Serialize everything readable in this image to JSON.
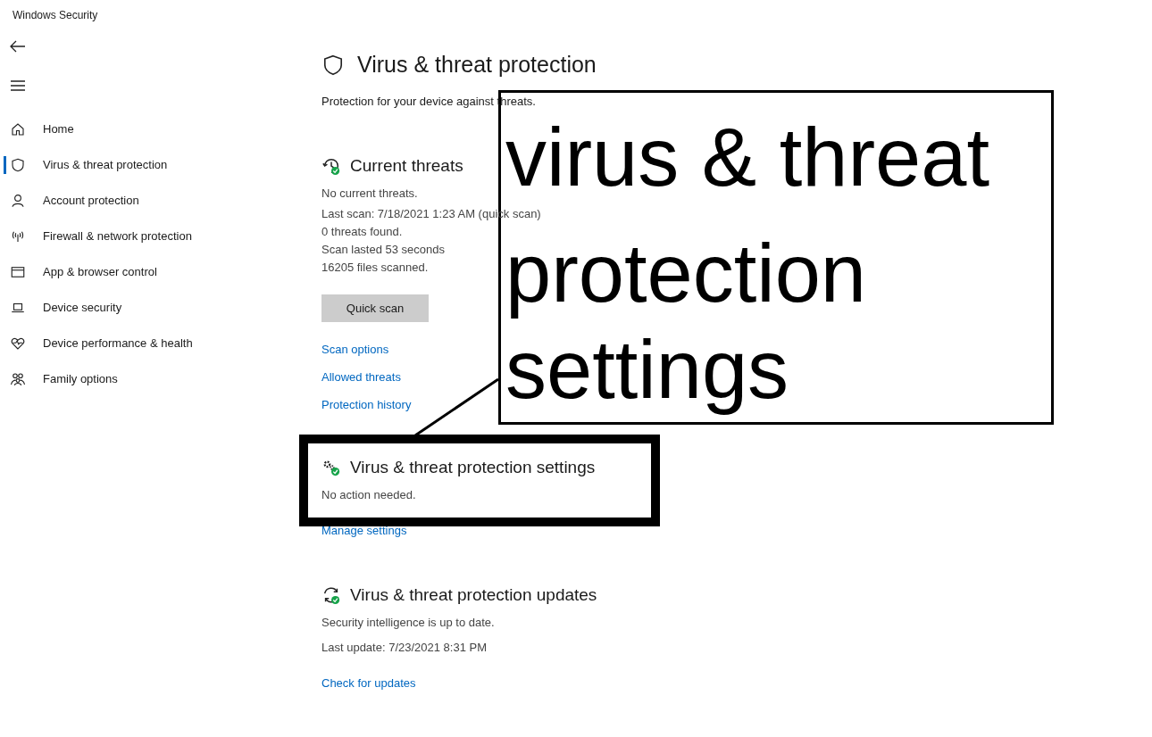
{
  "window": {
    "title": "Windows Security"
  },
  "sidebar": {
    "items": [
      {
        "label": "Home",
        "kind": "home",
        "selected": false
      },
      {
        "label": "Virus & threat protection",
        "kind": "shield",
        "selected": true
      },
      {
        "label": "Account protection",
        "kind": "person",
        "selected": false
      },
      {
        "label": "Firewall & network protection",
        "kind": "antenna",
        "selected": false
      },
      {
        "label": "App & browser control",
        "kind": "window",
        "selected": false
      },
      {
        "label": "Device security",
        "kind": "laptop",
        "selected": false
      },
      {
        "label": "Device performance & health",
        "kind": "heart",
        "selected": false
      },
      {
        "label": "Family options",
        "kind": "family",
        "selected": false
      }
    ]
  },
  "page": {
    "title": "Virus & threat protection",
    "subtitle": "Protection for your device against threats.",
    "sections": [
      {
        "kind": "threats",
        "title": "Current threats",
        "status": "No current threats.",
        "details": [
          "Last scan: 7/18/2021 1:23 AM (quick scan)",
          "0 threats found.",
          "Scan lasted 53 seconds",
          "16205 files scanned."
        ],
        "button": "Quick scan",
        "links": [
          "Scan options",
          "Allowed threats",
          "Protection history"
        ]
      },
      {
        "kind": "settings",
        "title": "Virus & threat protection settings",
        "status": "No action needed.",
        "links": [
          "Manage settings"
        ]
      },
      {
        "kind": "updates",
        "title": "Virus & threat protection updates",
        "status": "Security intelligence is up to date.",
        "details": [
          "Last update: 7/23/2021 8:31 PM"
        ],
        "links": [
          "Check for updates"
        ]
      }
    ]
  },
  "annotation": {
    "callout_lines": [
      "virus & threat",
      "protection",
      "settings"
    ]
  }
}
